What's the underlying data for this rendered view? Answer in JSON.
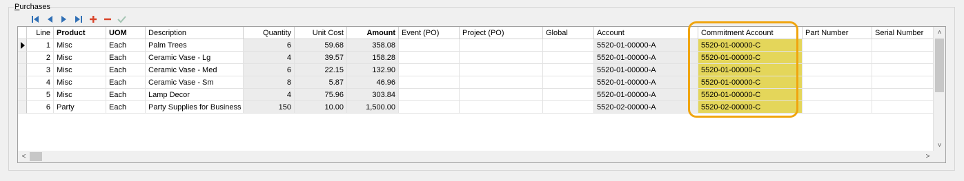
{
  "group": {
    "title_first": "P",
    "title_rest": "urchases"
  },
  "toolbar": {
    "icons": [
      "first-icon",
      "prev-icon",
      "next-icon",
      "last-icon",
      "add-icon",
      "delete-icon",
      "check-icon"
    ],
    "colors": {
      "nav": "#2f6fb5",
      "add": "#d9442b",
      "delete": "#d9442b",
      "check": "#a3c4b2"
    }
  },
  "columns": [
    {
      "key": "line",
      "label": "Line",
      "bold": false,
      "w": 39,
      "align": "r"
    },
    {
      "key": "product",
      "label": "Product",
      "bold": true,
      "w": 76,
      "align": "l"
    },
    {
      "key": "uom",
      "label": "UOM",
      "bold": true,
      "w": 57,
      "align": "l"
    },
    {
      "key": "desc",
      "label": "Description",
      "bold": false,
      "w": 142,
      "align": "l"
    },
    {
      "key": "qty",
      "label": "Quantity",
      "bold": false,
      "w": 74,
      "align": "r"
    },
    {
      "key": "unit",
      "label": "Unit Cost",
      "bold": false,
      "w": 76,
      "align": "r"
    },
    {
      "key": "amount",
      "label": "Amount",
      "bold": true,
      "w": 75,
      "align": "r"
    },
    {
      "key": "event",
      "label": "Event (PO)",
      "bold": false,
      "w": 88,
      "align": "l"
    },
    {
      "key": "project",
      "label": "Project (PO)",
      "bold": false,
      "w": 121,
      "align": "l"
    },
    {
      "key": "global",
      "label": "Global",
      "bold": false,
      "w": 74,
      "align": "l"
    },
    {
      "key": "account",
      "label": "Account",
      "bold": false,
      "w": 151,
      "align": "l"
    },
    {
      "key": "commit",
      "label": "Commitment Account",
      "bold": false,
      "w": 151,
      "align": "l"
    },
    {
      "key": "part",
      "label": "Part Number",
      "bold": false,
      "w": 101,
      "align": "l"
    },
    {
      "key": "serial",
      "label": "Serial Number",
      "bold": false,
      "w": 100,
      "align": "l"
    }
  ],
  "rows": [
    {
      "line": "1",
      "product": "Misc",
      "uom": "Each",
      "desc": "Palm Trees",
      "qty": "6",
      "unit": "59.68",
      "amount": "358.08",
      "event": "",
      "project": "",
      "global": "",
      "account": "5520-01-00000-A",
      "commit": "5520-01-00000-C",
      "part": "",
      "serial": "",
      "current": true
    },
    {
      "line": "2",
      "product": "Misc",
      "uom": "Each",
      "desc": "Ceramic Vase - Lg",
      "qty": "4",
      "unit": "39.57",
      "amount": "158.28",
      "event": "",
      "project": "",
      "global": "",
      "account": "5520-01-00000-A",
      "commit": "5520-01-00000-C",
      "part": "",
      "serial": ""
    },
    {
      "line": "3",
      "product": "Misc",
      "uom": "Each",
      "desc": "Ceramic Vase - Med",
      "qty": "6",
      "unit": "22.15",
      "amount": "132.90",
      "event": "",
      "project": "",
      "global": "",
      "account": "5520-01-00000-A",
      "commit": "5520-01-00000-C",
      "part": "",
      "serial": ""
    },
    {
      "line": "4",
      "product": "Misc",
      "uom": "Each",
      "desc": "Ceramic Vase - Sm",
      "qty": "8",
      "unit": "5.87",
      "amount": "46.96",
      "event": "",
      "project": "",
      "global": "",
      "account": "5520-01-00000-A",
      "commit": "5520-01-00000-C",
      "part": "",
      "serial": ""
    },
    {
      "line": "5",
      "product": "Misc",
      "uom": "Each",
      "desc": "Lamp Decor",
      "qty": "4",
      "unit": "75.96",
      "amount": "303.84",
      "event": "",
      "project": "",
      "global": "",
      "account": "5520-01-00000-A",
      "commit": "5520-01-00000-C",
      "part": "",
      "serial": ""
    },
    {
      "line": "6",
      "product": "Party",
      "uom": "Each",
      "desc": "Party Supplies for Business",
      "qty": "150",
      "unit": "10.00",
      "amount": "1,500.00",
      "event": "",
      "project": "",
      "global": "",
      "account": "5520-02-00000-A",
      "commit": "5520-02-00000-C",
      "part": "",
      "serial": ""
    }
  ],
  "styles": {
    "gray_cols": [
      "qty",
      "unit",
      "amount",
      "account"
    ],
    "yellow_col": "commit",
    "highlight_color": "#f0a50f"
  }
}
